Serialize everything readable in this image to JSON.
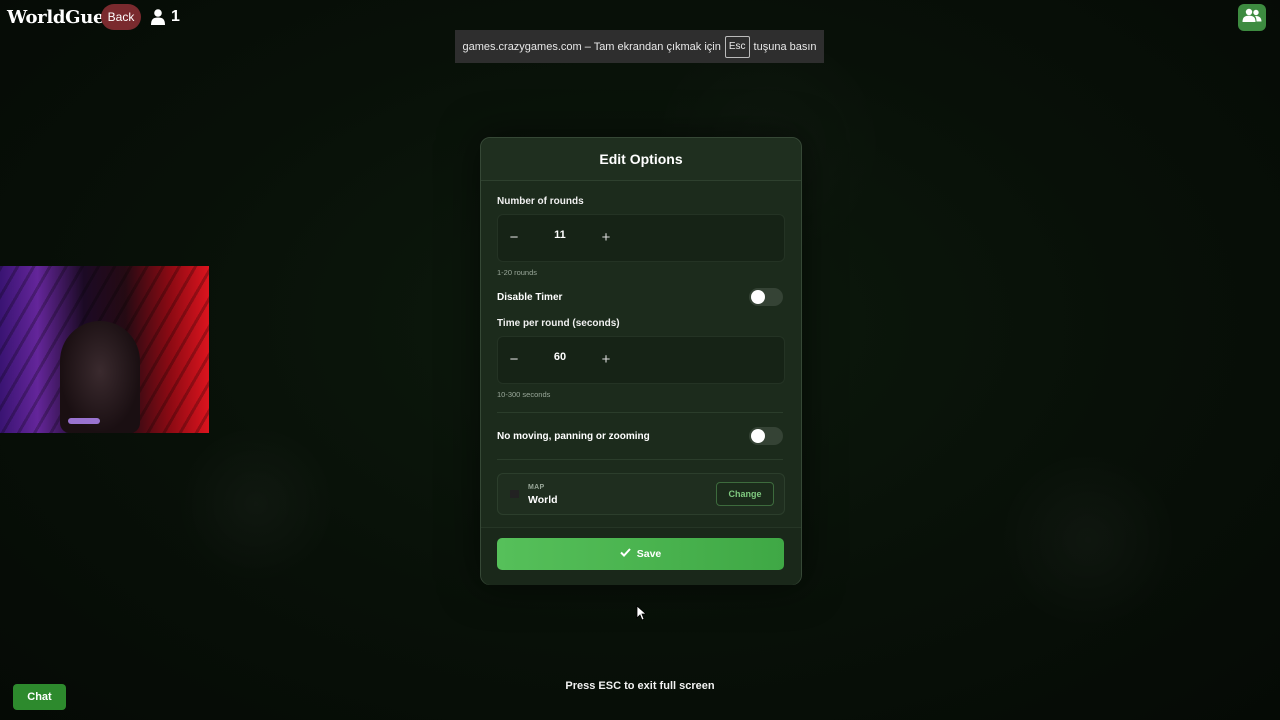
{
  "app": {
    "title": "WorldGuessr",
    "back_label": "Back",
    "player_count": "1"
  },
  "fullscreen_notice": {
    "text_before": "games.crazygames.com – Tam ekrandan çıkmak için",
    "key": "Esc",
    "text_after": "tuşuna basın"
  },
  "dialog": {
    "title": "Edit Options",
    "rounds": {
      "label": "Number of rounds",
      "value": "11",
      "hint": "1-20 rounds",
      "minus": "−",
      "plus": "+"
    },
    "disable_timer": {
      "label": "Disable Timer",
      "on": false
    },
    "time": {
      "label": "Time per round (seconds)",
      "value": "60",
      "hint": "10-300 seconds",
      "minus": "−",
      "plus": "+"
    },
    "no_move": {
      "label": "No moving, panning or zooming",
      "on": false
    },
    "map": {
      "label": "MAP",
      "name": "World",
      "change_label": "Change"
    },
    "save_label": "Save"
  },
  "chat_label": "Chat",
  "press_esc": "Press ESC to exit full screen",
  "colors": {
    "accent": "#4caf50",
    "back": "#7a2a2e",
    "panel": "#1c2b1c"
  }
}
